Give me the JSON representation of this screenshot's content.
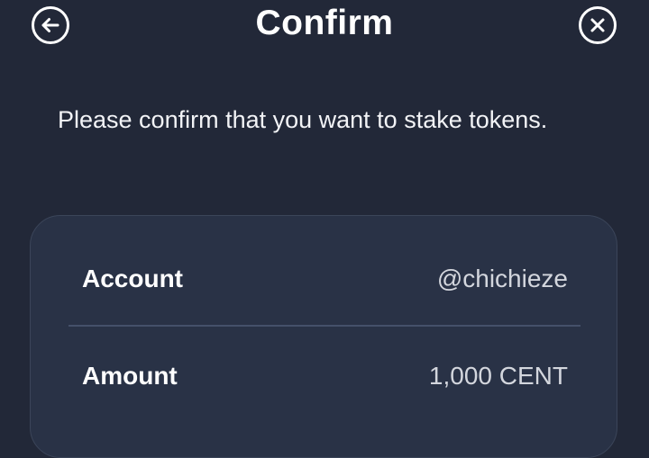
{
  "header": {
    "title": "Confirm",
    "back_icon": "arrow-left-circle-icon",
    "close_icon": "close-circle-icon"
  },
  "message": "Please confirm that you want to stake tokens.",
  "details": {
    "rows": [
      {
        "label": "Account",
        "value": "@chichieze"
      },
      {
        "label": "Amount",
        "value": "1,000 CENT"
      }
    ]
  },
  "colors": {
    "background": "#222838",
    "card": "#293246",
    "card_border": "#3b4559",
    "text": "#ffffff",
    "value_text": "#d3d6dd"
  }
}
